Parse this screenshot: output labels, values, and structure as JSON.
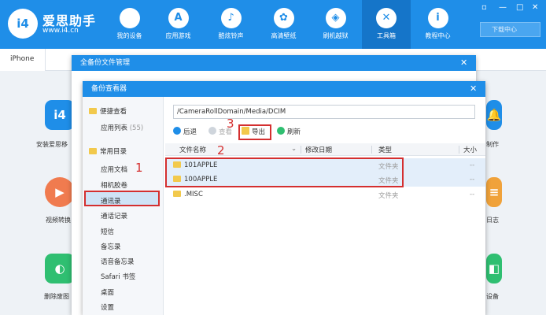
{
  "app": {
    "brand": "爱思助手",
    "url": "www.i4.cn",
    "logo_text": "i4"
  },
  "nav": [
    {
      "label": "我的设备",
      "icon": "apple-icon",
      "glyph": ""
    },
    {
      "label": "应用游戏",
      "icon": "appstore-icon",
      "glyph": "A"
    },
    {
      "label": "酷炫铃声",
      "icon": "bell-icon",
      "glyph": "♪"
    },
    {
      "label": "高清壁纸",
      "icon": "flower-icon",
      "glyph": "✿"
    },
    {
      "label": "刷机越狱",
      "icon": "box-icon",
      "glyph": "◈"
    },
    {
      "label": "工具箱",
      "icon": "tools-icon",
      "glyph": "✕"
    },
    {
      "label": "教程中心",
      "icon": "info-icon",
      "glyph": "i"
    }
  ],
  "window_controls": [
    "▫",
    "—",
    "□",
    "✕"
  ],
  "download_center": "下载中心",
  "tabs": [
    {
      "label": "iPhone"
    }
  ],
  "background_tools": [
    {
      "label": "安装爱思移",
      "glyph": "i4",
      "color": "#1f8ee8"
    },
    {
      "label": "视频转换",
      "glyph": "▶",
      "color": "#f07b4f"
    },
    {
      "label": "删除废图",
      "glyph": "◐",
      "color": "#2fbf71"
    },
    {
      "label": "制作",
      "glyph": "🔔",
      "color": "#1f8ee8"
    },
    {
      "label": "日志",
      "glyph": "≡",
      "color": "#f0a23a"
    },
    {
      "label": "设备",
      "glyph": "◧",
      "color": "#2fbf71"
    }
  ],
  "outer_dialog": {
    "title": "全备份文件管理",
    "close": "✕"
  },
  "inner_dialog": {
    "title": "备份查看器",
    "close": "✕"
  },
  "sidebar": {
    "group1": "便捷查看",
    "app_list": "应用列表",
    "app_count": "(55)",
    "group2": "常用目录",
    "items": [
      "应用文档",
      "相机胶卷",
      "通讯录",
      "通话记录",
      "短信",
      "备忘录",
      "语音备忘录",
      "Safari 书签",
      "桌面",
      "设置"
    ]
  },
  "path": "/CameraRollDomain/Media/DCIM",
  "toolbar": {
    "back": "后退",
    "view": "查看",
    "export": "导出",
    "refresh": "刷新"
  },
  "columns": {
    "name": "文件名称",
    "date": "修改日期",
    "type": "类型",
    "size": "大小"
  },
  "rows": [
    {
      "name": "101APPLE",
      "type": "文件夹",
      "size": "--"
    },
    {
      "name": "100APPLE",
      "type": "文件夹",
      "size": "--"
    },
    {
      "name": ".MISC",
      "type": "文件夹",
      "size": "--"
    }
  ],
  "annotations": [
    "1",
    "2",
    "3"
  ],
  "colors": {
    "accent": "#1f8ee8",
    "highlight": "#d42f2f",
    "folder": "#f2c94c"
  }
}
